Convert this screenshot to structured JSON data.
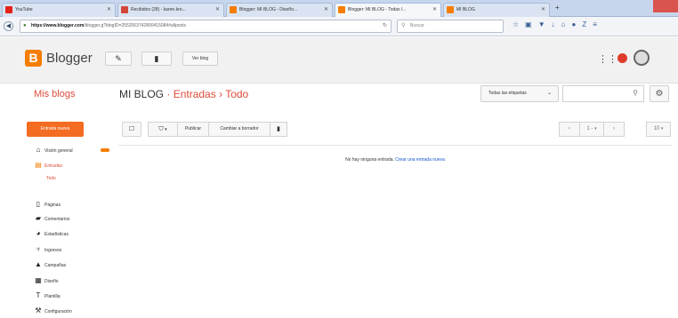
{
  "browser": {
    "tabs": [
      {
        "title": "YouTube",
        "color": "#e62117"
      },
      {
        "title": "Recibidos (28) - karen.kro...",
        "color": "#d44638"
      },
      {
        "title": "Blogger: MI BLOG - Diseño...",
        "color": "#f57d00"
      },
      {
        "title": "Blogger: MI BLOG - Todas l...",
        "color": "#f57d00"
      },
      {
        "title": "MI BLOG",
        "color": "#f57d00"
      }
    ],
    "url_host": "https://www.blogger.com",
    "url_path": "/blogger.g?blogID=2552063742800415084#allposts",
    "search_placeholder": "Buscar"
  },
  "header": {
    "brand": "Blogger",
    "view_blog_label": "Ver blog"
  },
  "title_row": {
    "my_blogs": "Mis blogs",
    "blog_name": "MI BLOG",
    "sep1": "·",
    "section": "Entradas",
    "sep2": "›",
    "view": "Todo",
    "labels_dropdown": "Todas las etiquetas",
    "search_value": ""
  },
  "sidebar": {
    "new_post": "Entrada nueva",
    "items": [
      {
        "label": "Visión general",
        "icon": "home-icon",
        "glyph": "⌂"
      },
      {
        "label": "Entradas",
        "icon": "posts-icon",
        "glyph": "▤"
      },
      {
        "label": "Páginas",
        "icon": "pages-icon",
        "glyph": "▯"
      },
      {
        "label": "Comentarios",
        "icon": "comments-icon",
        "glyph": "▰"
      },
      {
        "label": "Estadísticas",
        "icon": "stats-icon",
        "glyph": "◕"
      },
      {
        "label": "Ingresos",
        "icon": "trophy-icon",
        "glyph": "♆"
      },
      {
        "label": "Campañas",
        "icon": "campaigns-icon",
        "glyph": "▲"
      },
      {
        "label": "Diseño",
        "icon": "layout-icon",
        "glyph": "▦"
      },
      {
        "label": "Plantilla",
        "icon": "template-icon",
        "glyph": "T"
      },
      {
        "label": "Configuración",
        "icon": "wrench-icon",
        "glyph": "⚒"
      }
    ],
    "sub_todo": "Todo"
  },
  "toolbar": {
    "publish": "Publicar",
    "revert_draft": "Cambiar a borrador",
    "pager_range": "1 - ",
    "per_page": "10"
  },
  "empty": {
    "message": "No hay ninguna entrada.",
    "create_link": "Crear una entrada nueva"
  },
  "colors": {
    "accent": "#dd4b39",
    "brand_orange": "#f57d00",
    "new_post_button": "#f36c21",
    "link": "#1155cc"
  }
}
